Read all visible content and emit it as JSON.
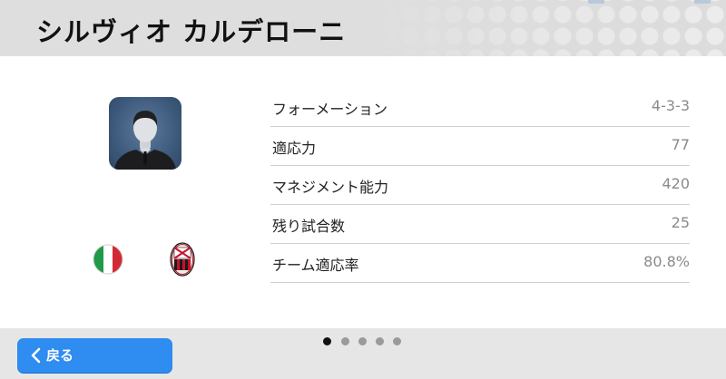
{
  "header": {
    "title": "シルヴィオ カルデローニ"
  },
  "profile": {
    "avatar_icon": "person-silhouette-icon",
    "nationality_icon": "italy-flag-icon",
    "club_icon": "ac-milan-crest-icon"
  },
  "stats": [
    {
      "label": "フォーメーション",
      "value": "4-3-3"
    },
    {
      "label": "適応力",
      "value": "77"
    },
    {
      "label": "マネジメント能力",
      "value": "420"
    },
    {
      "label": "残り試合数",
      "value": "25"
    },
    {
      "label": "チーム適応率",
      "value": "80.8%"
    }
  ],
  "pagination": {
    "total": 5,
    "current": 1
  },
  "footer": {
    "back_label": "戻る",
    "back_icon": "chevron-left-icon"
  },
  "colors": {
    "accent": "#2f8cf0",
    "header_bg": "#dcdcdc",
    "footer_bg": "#e6e6e6"
  }
}
